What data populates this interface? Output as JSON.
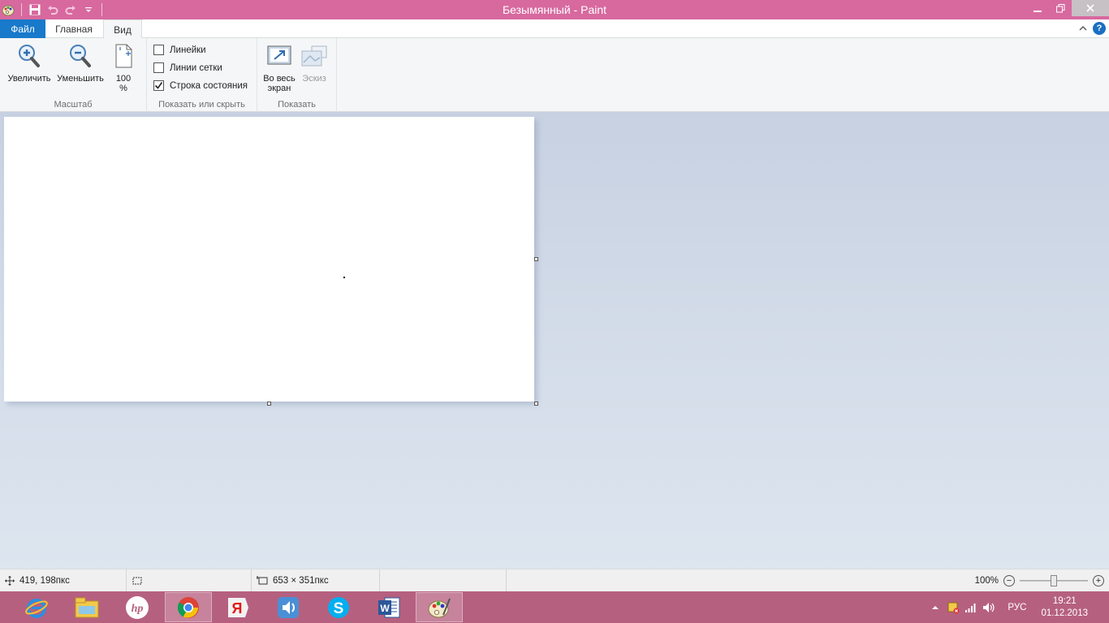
{
  "window": {
    "title": "Безымянный - Paint"
  },
  "tabs": {
    "file": "Файл",
    "home": "Главная",
    "view": "Вид"
  },
  "ribbon": {
    "zoom_group": {
      "label": "Масштаб",
      "zoom_in": "Увеличить",
      "zoom_out": "Уменьшить",
      "hundred_line1": "100",
      "hundred_line2": "%"
    },
    "show_group": {
      "label": "Показать или скрыть",
      "rulers": {
        "label": "Линейки",
        "checked": false
      },
      "gridlines": {
        "label": "Линии сетки",
        "checked": false
      },
      "statusbar": {
        "label": "Строка состояния",
        "checked": true
      }
    },
    "display_group": {
      "label": "Показать",
      "fullscreen_line1": "Во весь",
      "fullscreen_line2": "экран",
      "thumbnail": "Эскиз"
    }
  },
  "statusbar": {
    "cursor_pos": "419, 198пкс",
    "image_size": "653 × 351пкс",
    "zoom": "100%",
    "zoom_level_fraction": 0.5
  },
  "taskbar": {
    "apps": [
      "internet-explorer",
      "file-explorer",
      "hp",
      "chrome",
      "yandex",
      "speaker-app",
      "skype",
      "word",
      "paint"
    ],
    "tray": {
      "language": "РУС",
      "time": "19:21",
      "date": "01.12.2013"
    }
  },
  "colors": {
    "titlebar": "#d7699f",
    "taskbar": "#b6607f",
    "file_tab": "#1979ca",
    "workspace_top": "#c7d1e2",
    "workspace_bottom": "#dde5ef"
  }
}
